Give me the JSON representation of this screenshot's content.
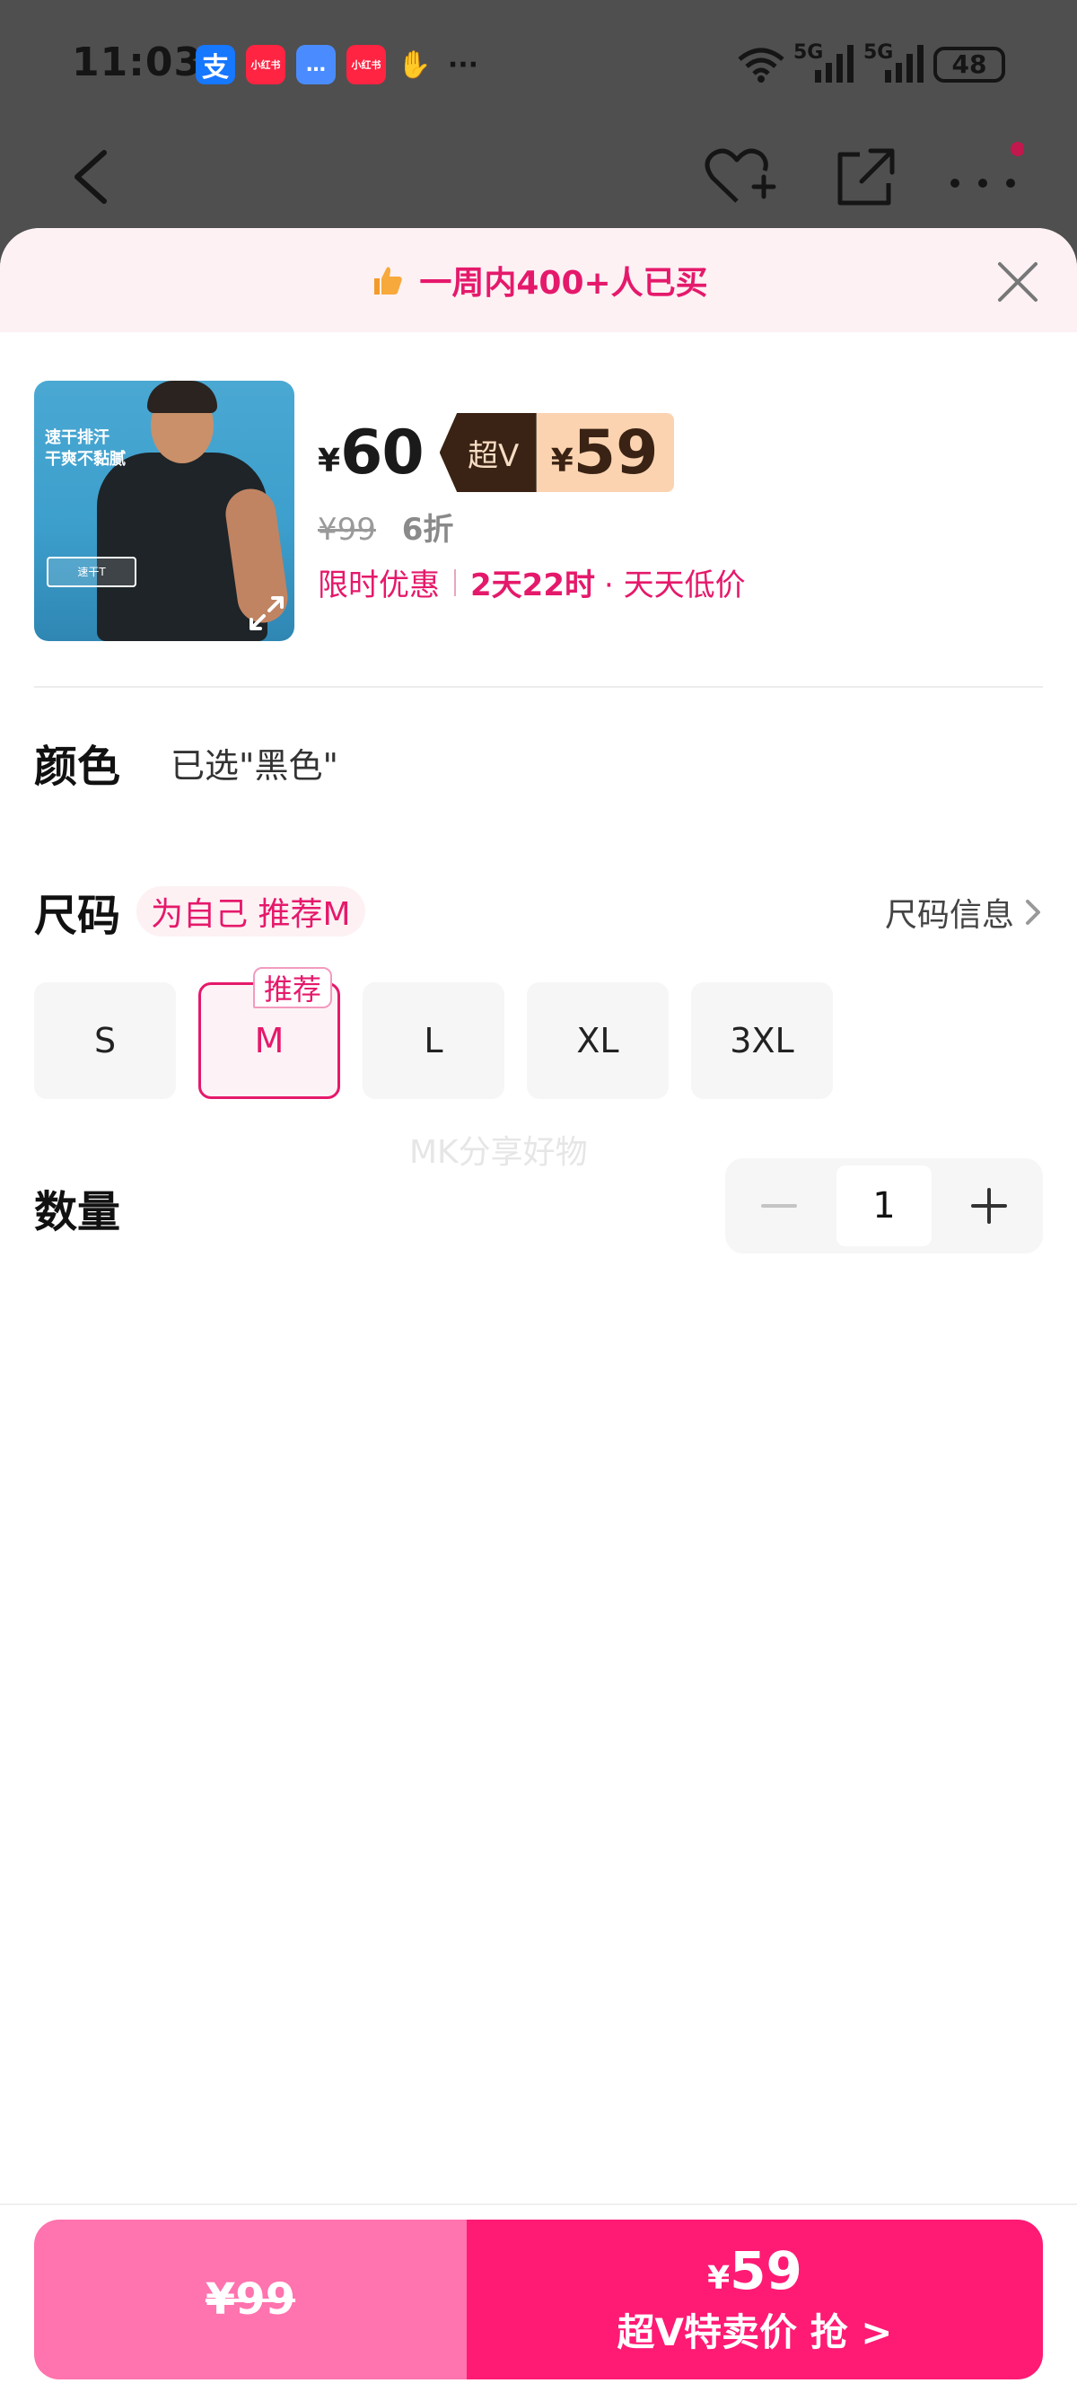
{
  "status_bar": {
    "time": "11:03",
    "apps": [
      {
        "label": "支",
        "color": "#1677ff"
      },
      {
        "label": "小红书",
        "color": "#ff2442"
      },
      {
        "label": "…",
        "color": "#4a8cff"
      },
      {
        "label": "小红书",
        "color": "#ff2442"
      }
    ],
    "network1": "5G",
    "network2": "5G",
    "battery": "48"
  },
  "banner": {
    "text": "一周内400+人已买",
    "icon": "thumbs-up-icon"
  },
  "product": {
    "thumb_tagline": "速干排汗\n干爽不黏腻",
    "thumb_tag": "速干T",
    "price_yen": "¥",
    "price": "60",
    "vip_label": "超V",
    "vip_price_yen": "¥",
    "vip_price": "59",
    "original_price": "¥99",
    "discount": "6折",
    "promo_label": "限时优惠",
    "promo_countdown": "2天22时",
    "promo_suffix": "· 天天低价"
  },
  "color": {
    "title": "颜色",
    "selected_text": "已选\"黑色\""
  },
  "size": {
    "title": "尺码",
    "recommendation": "为自己 推荐M",
    "info_link": "尺码信息",
    "options": [
      "S",
      "M",
      "L",
      "XL",
      "3XL"
    ],
    "selected": "M",
    "recommended_badge": "推荐"
  },
  "watermark": "MK分享好物",
  "quantity": {
    "title": "数量",
    "value": "1"
  },
  "bottom": {
    "left_price": "¥99",
    "right_yen": "¥",
    "right_price": "59",
    "right_cta": "超V特卖价 抢 >"
  },
  "colors": {
    "accent": "#e5196b",
    "vip_dark": "#3a2314",
    "vip_light": "#fbd3b0",
    "buy_left": "#ff73ae",
    "buy_right": "#ff1a74"
  }
}
